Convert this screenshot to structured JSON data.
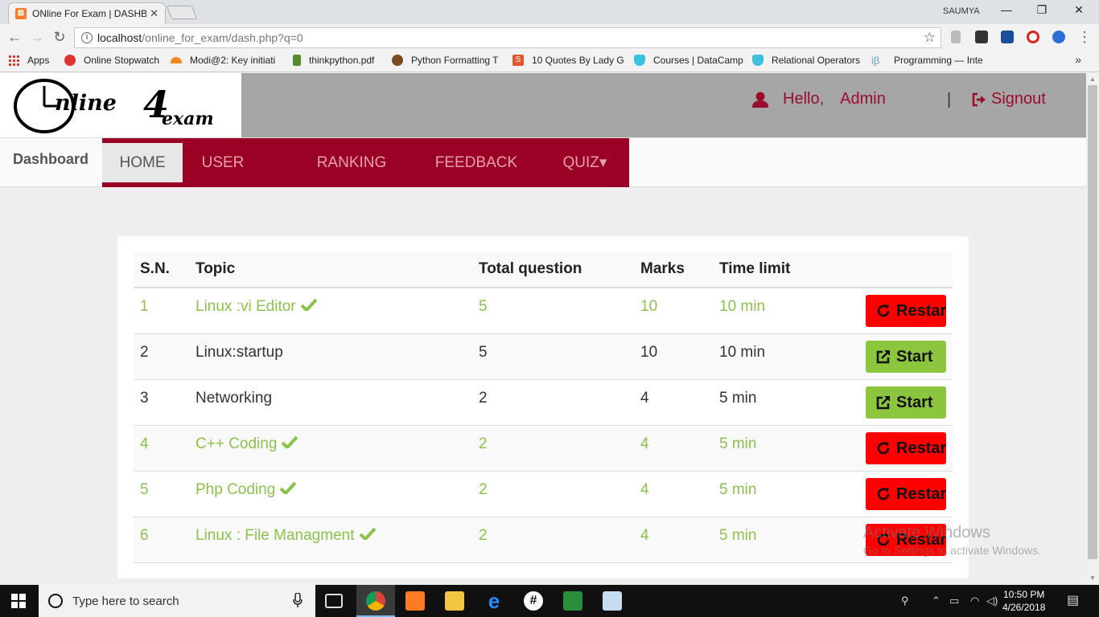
{
  "browser": {
    "tab_title": "ONline For Exam | DASHB",
    "tab_favicon": "xampp-icon",
    "user_badge": "SAUMYA",
    "url_host": "localhost",
    "url_path": "/online_for_exam/dash.php?q=0",
    "bookmarks": [
      "Apps",
      "Online Stopwatch",
      "Modi@2: Key initiati",
      "thinkpython.pdf",
      "Python Formatting T",
      "10 Quotes By Lady G",
      "Courses | DataCamp",
      "Relational Operators",
      "Programming — Inte"
    ],
    "more": "»"
  },
  "header": {
    "logo_main": "nline",
    "logo_four": "4",
    "logo_exam": "exam",
    "hello": "Hello,",
    "admin": "Admin",
    "separator": "|",
    "signout": "Signout"
  },
  "nav": {
    "brand": "Dashboard",
    "items": [
      "HOME",
      "USER",
      "RANKING",
      "FEEDBACK",
      "QUIZ▾"
    ],
    "active": "HOME",
    "menu_color": "#9b0025"
  },
  "table": {
    "headers": [
      "S.N.",
      "Topic",
      "Total question",
      "Marks",
      "Time limit"
    ],
    "rows": [
      {
        "sn": "1",
        "topic": "Linux :vi Editor",
        "total": "5",
        "marks": "10",
        "time": "10 min",
        "done": true,
        "action": "Restart"
      },
      {
        "sn": "2",
        "topic": "Linux:startup",
        "total": "5",
        "marks": "10",
        "time": "10 min",
        "done": false,
        "action": "Start"
      },
      {
        "sn": "3",
        "topic": "Networking",
        "total": "2",
        "marks": "4",
        "time": "5 min",
        "done": false,
        "action": "Start"
      },
      {
        "sn": "4",
        "topic": "C++ Coding",
        "total": "2",
        "marks": "4",
        "time": "5 min",
        "done": true,
        "action": "Restart"
      },
      {
        "sn": "5",
        "topic": "Php Coding",
        "total": "2",
        "marks": "4",
        "time": "5 min",
        "done": true,
        "action": "Restart"
      },
      {
        "sn": "6",
        "topic": "Linux : File Managment",
        "total": "2",
        "marks": "4",
        "time": "5 min",
        "done": true,
        "action": "Restart"
      }
    ],
    "done_color": "#8bc34a",
    "restart_color": "#ff0000",
    "start_color": "#8cc63f"
  },
  "watermark": {
    "line1": "Activate Windows",
    "line2": "Go to Settings to activate Windows."
  },
  "taskbar": {
    "search_placeholder": "Type here to search",
    "time": "10:50 PM",
    "date": "4/26/2018"
  }
}
